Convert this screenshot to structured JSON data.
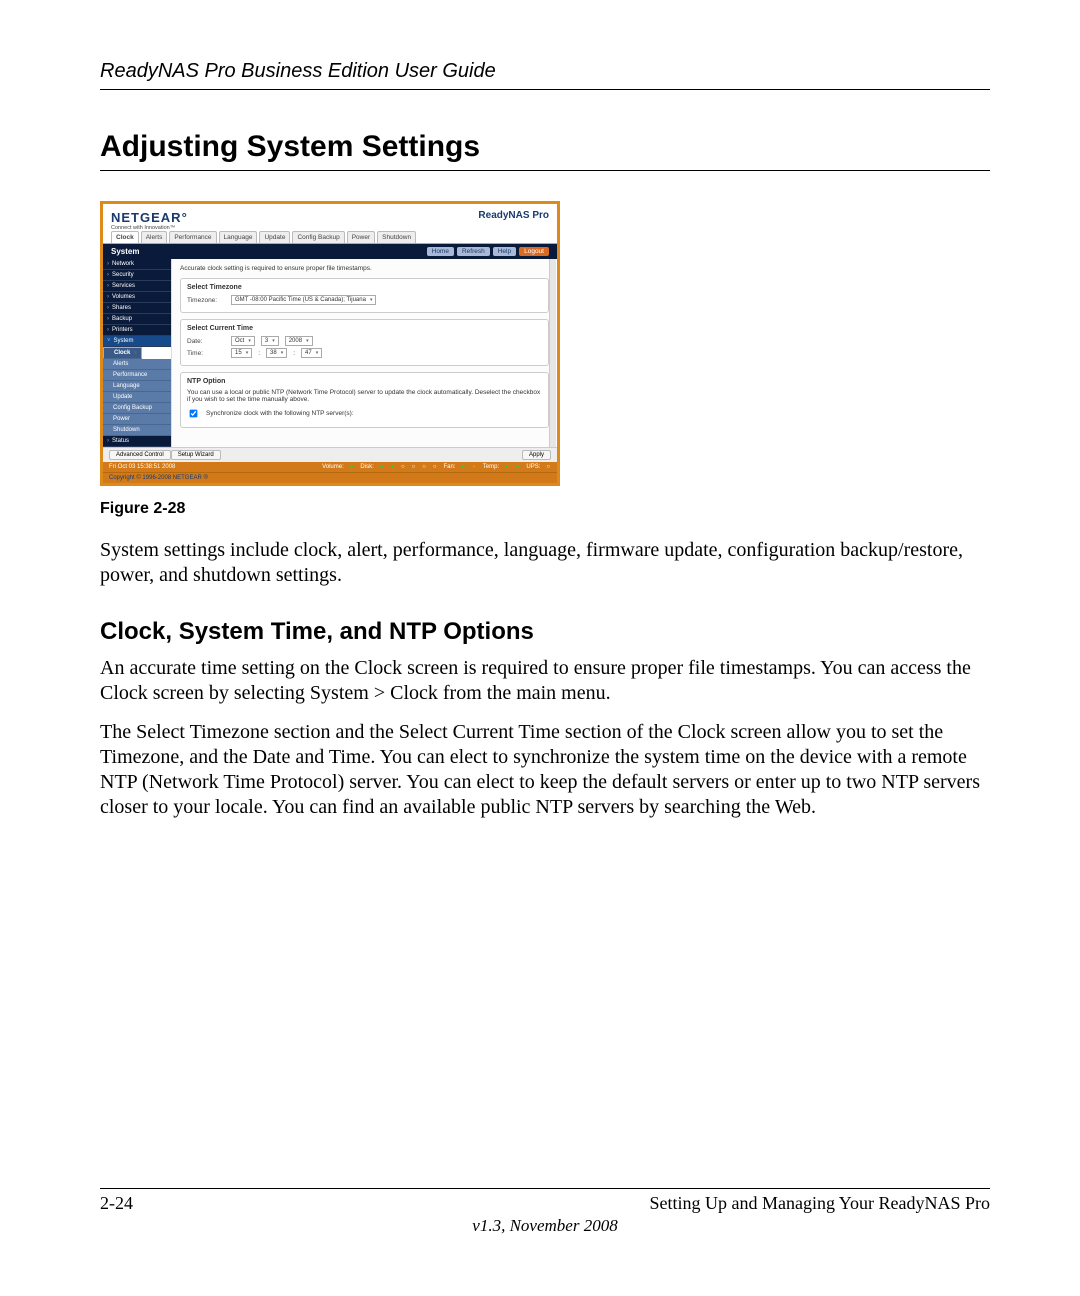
{
  "doc": {
    "running_head": "ReadyNAS Pro Business Edition User Guide",
    "section_title": "Adjusting System Settings",
    "figure_caption": "Figure 2-28",
    "para1": "System settings include clock, alert, performance, language, firmware update, configuration backup/restore, power, and shutdown settings.",
    "subsection_title": "Clock, System Time, and NTP Options",
    "para2": "An accurate time setting on the Clock screen is required to ensure proper file timestamps. You can access the Clock screen by selecting System > Clock from the main menu.",
    "para3": "The Select Timezone section and the Select Current Time section of the Clock screen allow you to set the Timezone, and the Date and Time. You can elect to synchronize the system time on the device with a remote NTP (Network Time Protocol) server. You can elect to keep the default servers or enter up to two NTP servers closer to your locale. You can find an available public NTP servers by searching the Web.",
    "page_left": "2-24",
    "page_right": "Setting Up and Managing Your ReadyNAS Pro",
    "version": "v1.3, November 2008"
  },
  "ui": {
    "brand": "NETGEAR",
    "brand_tag": "Connect with Innovation™",
    "product": "ReadyNAS Pro",
    "tabs": [
      "Clock",
      "Alerts",
      "Performance",
      "Language",
      "Update",
      "Config Backup",
      "Power",
      "Shutdown"
    ],
    "active_tab": "Clock",
    "crumb": "System",
    "topbtn_home": "Home",
    "topbtn_refresh": "Refresh",
    "topbtn_help": "Help",
    "topbtn_logout": "Logout",
    "sidebar_groups": [
      "Network",
      "Security",
      "Services",
      "Volumes",
      "Shares",
      "Backup",
      "Printers"
    ],
    "sidebar_open": "System",
    "sidebar_sub": [
      "Clock",
      "Alerts",
      "Performance",
      "Language",
      "Update",
      "Config Backup",
      "Power",
      "Shutdown"
    ],
    "sidebar_last": "Status",
    "note": "Accurate clock setting is required to ensure proper file timestamps.",
    "panel_tz_title": "Select Timezone",
    "tz_label": "Timezone:",
    "tz_value": "GMT -08:00 Pacific Time (US & Canada); Tijuana",
    "panel_time_title": "Select Current Time",
    "date_label": "Date:",
    "date_month": "Oct",
    "date_day": "3",
    "date_year": "2008",
    "time_label": "Time:",
    "time_h": "15",
    "time_m": "38",
    "time_s": "47",
    "panel_ntp_title": "NTP Option",
    "ntp_desc": "You can use a local or public NTP (Network Time Protocol) server to update the clock automatically. Deselect the checkbox if you wish to set the time manually above.",
    "ntp_check_label": "Synchronize clock with the following NTP server(s):",
    "btn_adv": "Advanced Control",
    "btn_wiz": "Setup Wizard",
    "btn_apply": "Apply",
    "status_time": "Fri Oct 03  15:38:51 2008",
    "status_vol": "Volume:",
    "status_disk": "Disk:",
    "status_fan": "Fan:",
    "status_temp": "Temp:",
    "status_ups": "UPS:",
    "copyright": "Copyright © 1996-2008 NETGEAR ®"
  }
}
